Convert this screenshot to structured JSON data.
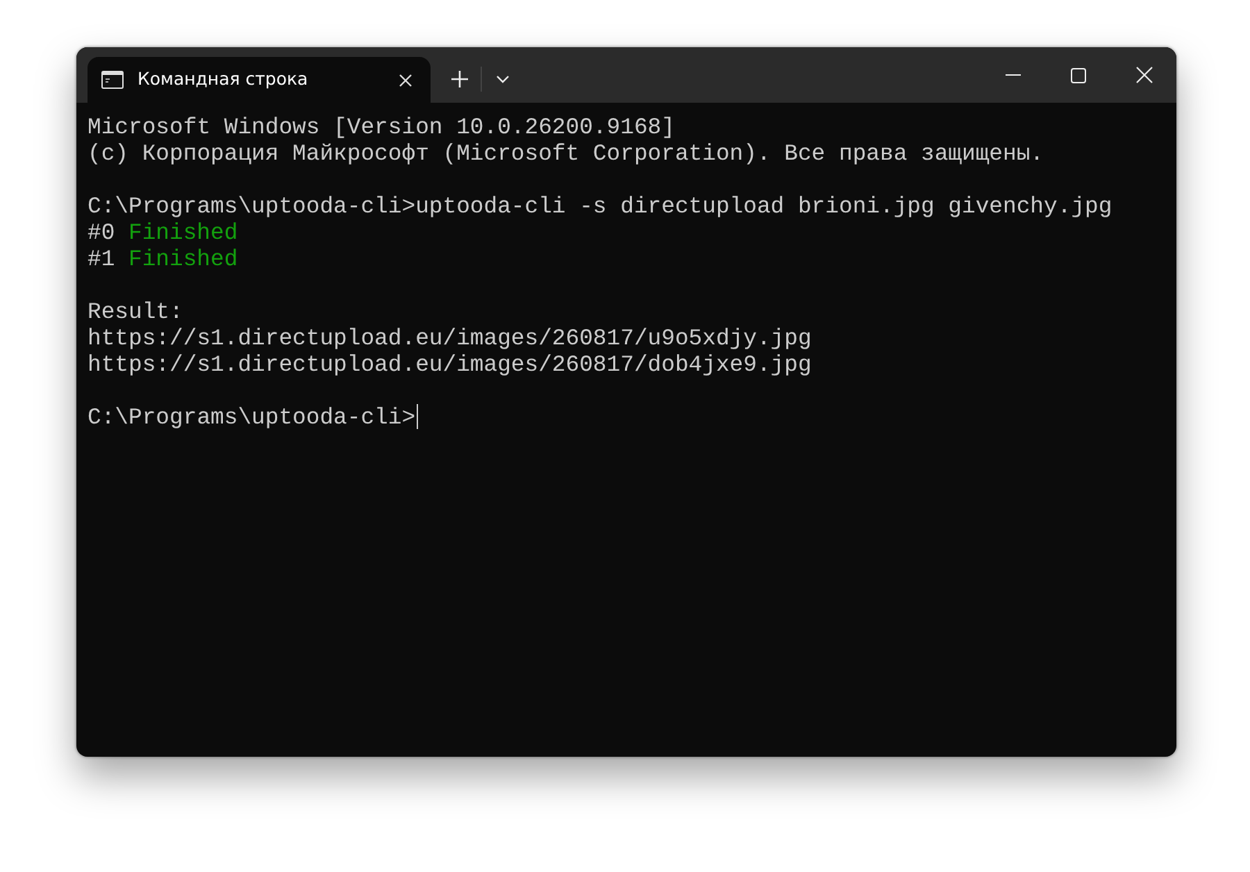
{
  "window": {
    "tabs": [
      {
        "title": "Командная строка",
        "selected": true
      }
    ]
  },
  "terminal": {
    "lines": [
      {
        "kind": "text",
        "segments": [
          {
            "text": "Microsoft Windows [Version 10.0.26200.9168]",
            "kind": "normal"
          }
        ]
      },
      {
        "kind": "text",
        "segments": [
          {
            "text": "(c) Корпорация Майкрософт (Microsoft Corporation). Все права защищены.",
            "kind": "normal"
          }
        ]
      },
      {
        "kind": "blank"
      },
      {
        "kind": "text",
        "segments": [
          {
            "text": "C:\\Programs\\uptooda-cli>uptooda-cli -s directupload brioni.jpg givenchy.jpg",
            "kind": "normal"
          }
        ]
      },
      {
        "kind": "text",
        "segments": [
          {
            "text": "#0",
            "kind": "normal"
          },
          {
            "text": "Finished",
            "kind": "success"
          }
        ]
      },
      {
        "kind": "text",
        "segments": [
          {
            "text": "#1",
            "kind": "normal"
          },
          {
            "text": "Finished",
            "kind": "success"
          }
        ]
      },
      {
        "kind": "blank"
      },
      {
        "kind": "text",
        "segments": [
          {
            "text": "Result:",
            "kind": "normal"
          }
        ]
      },
      {
        "kind": "text",
        "segments": [
          {
            "text": "https://s1.directupload.eu/images/260817/u9o5xdjy.jpg",
            "kind": "normal"
          }
        ]
      },
      {
        "kind": "text",
        "segments": [
          {
            "text": "https://s1.directupload.eu/images/260817/dob4jxe9.jpg",
            "kind": "normal"
          }
        ]
      },
      {
        "kind": "blank"
      },
      {
        "kind": "prompt",
        "segments": [
          {
            "text": "C:\\Programs\\uptooda-cli>",
            "kind": "normal"
          }
        ],
        "cursor": true
      }
    ]
  }
}
